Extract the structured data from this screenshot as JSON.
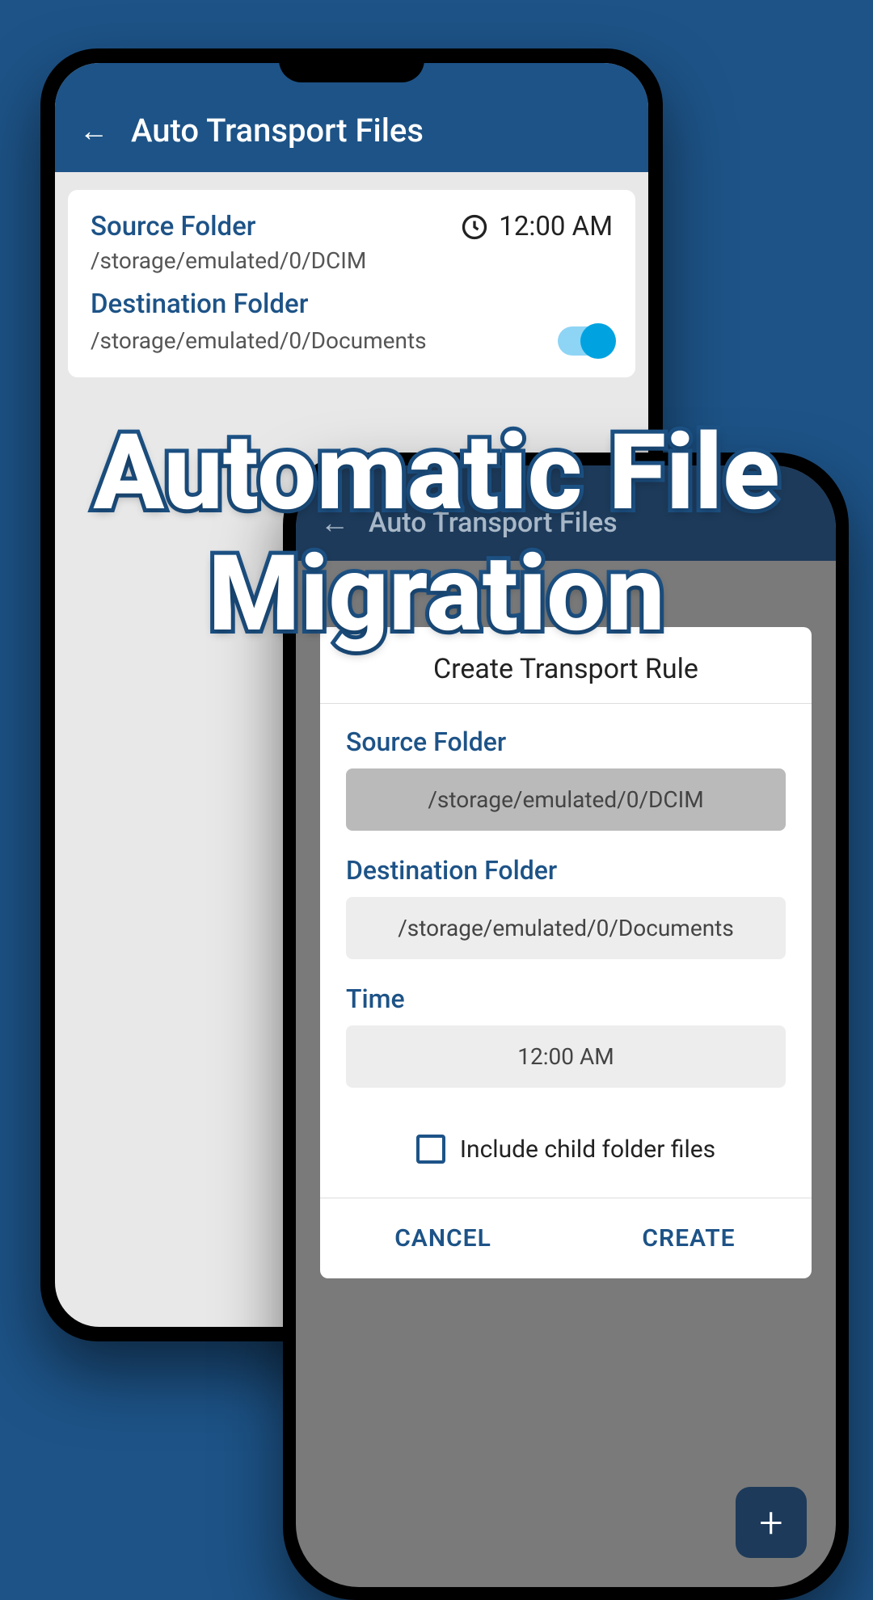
{
  "overlay": {
    "line1": "Automatic File",
    "line2": "Migration"
  },
  "phone1": {
    "header_title": "Auto Transport Files",
    "card": {
      "source_label": "Source Folder",
      "source_path": "/storage/emulated/0/DCIM",
      "time": "12:00 AM",
      "dest_label": "Destination Folder",
      "dest_path": "/storage/emulated/0/Documents"
    }
  },
  "phone2": {
    "header_title": "Auto Transport Files",
    "dialog": {
      "title": "Create Transport Rule",
      "source_label": "Source Folder",
      "source_value": "/storage/emulated/0/DCIM",
      "dest_label": "Destination Folder",
      "dest_value": "/storage/emulated/0/Documents",
      "time_label": "Time",
      "time_value": "12:00 AM",
      "checkbox_label": "Include child folder files",
      "cancel": "CANCEL",
      "create": "CREATE"
    }
  }
}
